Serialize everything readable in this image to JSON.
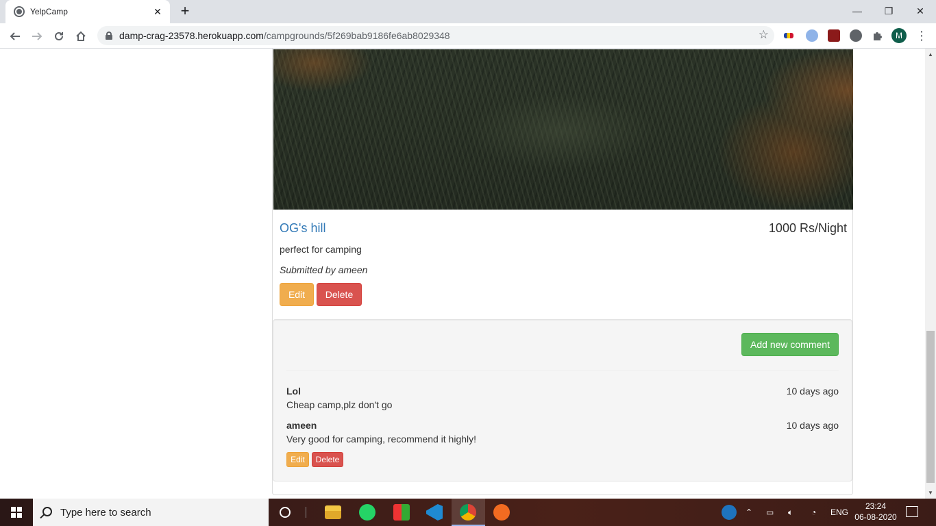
{
  "browser": {
    "tab_title": "YelpCamp",
    "tab_close": "✕",
    "new_tab": "+",
    "url_host": "damp-crag-23578.herokuapp.com",
    "url_path": "/campgrounds/5f269bab9186fe6ab8029348",
    "profile_initial": "M",
    "window_controls": {
      "minimize": "—",
      "restore": "❐",
      "close": "✕"
    }
  },
  "campground": {
    "name": "OG's hill",
    "price": "1000 Rs/Night",
    "description": "perfect for camping",
    "submitted_by": "Submitted by ameen",
    "edit_label": "Edit",
    "delete_label": "Delete"
  },
  "comments_section": {
    "add_label": "Add new comment",
    "comments": [
      {
        "author": "Lol",
        "time": "10 days ago",
        "text": "Cheap camp,plz don't go"
      },
      {
        "author": "ameen",
        "time": "10 days ago",
        "text": "Very good for camping, recommend it highly!"
      }
    ],
    "edit_label": "Edit",
    "delete_label": "Delete"
  },
  "taskbar": {
    "search_placeholder": "Type here to search",
    "language": "ENG",
    "time": "23:24",
    "date": "06-08-2020"
  },
  "colors": {
    "link": "#337ab7",
    "warning": "#f0ad4e",
    "danger": "#d9534f",
    "success": "#5cb85c"
  }
}
